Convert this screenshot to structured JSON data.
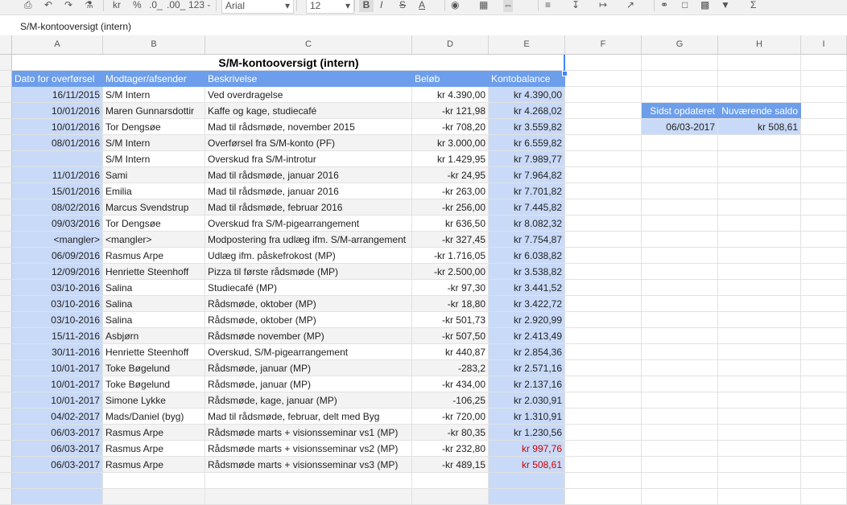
{
  "toolbar": {
    "currency_format": "kr",
    "percent_format": "%",
    "decrease_decimals": ".0_",
    "increase_decimals": ".00_",
    "more_formats": "123 -",
    "font_family": "Arial",
    "font_size": "12",
    "bold": "B",
    "italic": "I",
    "strikethrough": "S",
    "text_color": "A"
  },
  "formula_bar": {
    "value": "S/M-kontooversigt (intern)"
  },
  "columns": [
    "A",
    "B",
    "C",
    "D",
    "E",
    "F",
    "G",
    "H",
    "I"
  ],
  "sheet": {
    "title": "S/M-kontooversigt (intern)",
    "headers": {
      "date": "Dato for overførsel",
      "party": "Modtager/afsender",
      "desc": "Beskrivelse",
      "amount": "Beløb",
      "balance": "Kontobalance"
    },
    "rows": [
      {
        "date": "16/11/2015",
        "party": "S/M Intern",
        "desc": "Ved overdragelse",
        "amount": "kr 4.390,00",
        "balance": "kr 4.390,00",
        "neg": false
      },
      {
        "date": "10/01/2016",
        "party": "Maren Gunnarsdottir",
        "desc": "Kaffe og kage, studiecafé",
        "amount": "-kr 121,98",
        "balance": "kr 4.268,02",
        "neg": false
      },
      {
        "date": "10/01/2016",
        "party": "Tor Dengsøe",
        "desc": "Mad til rådsmøde, november 2015",
        "amount": "-kr 708,20",
        "balance": "kr 3.559,82",
        "neg": false
      },
      {
        "date": "08/01/2016",
        "party": "S/M Intern",
        "desc": "Overførsel fra S/M-konto (PF)",
        "amount": "kr 3.000,00",
        "balance": "kr 6.559,82",
        "neg": false
      },
      {
        "date": "",
        "party": "S/M Intern",
        "desc": "Overskud fra S/M-introtur",
        "amount": "kr 1.429,95",
        "balance": "kr 7.989,77",
        "neg": false
      },
      {
        "date": "11/01/2016",
        "party": "Sami",
        "desc": "Mad til rådsmøde, januar 2016",
        "amount": "-kr 24,95",
        "balance": "kr 7.964,82",
        "neg": false
      },
      {
        "date": "15/01/2016",
        "party": "Emilia",
        "desc": "Mad til rådsmøde, januar 2016",
        "amount": "-kr 263,00",
        "balance": "kr 7.701,82",
        "neg": false
      },
      {
        "date": "08/02/2016",
        "party": "Marcus Svendstrup",
        "desc": "Mad til rådsmøde, februar 2016",
        "amount": "-kr 256,00",
        "balance": "kr 7.445,82",
        "neg": false
      },
      {
        "date": "09/03/2016",
        "party": "Tor Dengsøe",
        "desc": "Overskud fra S/M-pigearrangement",
        "amount": "kr 636,50",
        "balance": "kr 8.082,32",
        "neg": false
      },
      {
        "date": "<mangler>",
        "party": "<mangler>",
        "desc": "Modpostering fra udlæg ifm. S/M-arrangement",
        "amount": "-kr 327,45",
        "balance": "kr 7.754,87",
        "neg": false
      },
      {
        "date": "06/09/2016",
        "party": "Rasmus Arpe",
        "desc": "Udlæg ifm. påskefrokost (MP)",
        "amount": "-kr 1.716,05",
        "balance": "kr 6.038,82",
        "neg": false
      },
      {
        "date": "12/09/2016",
        "party": "Henriette Steenhoff",
        "desc": "Pizza til første rådsmøde (MP)",
        "amount": "-kr 2.500,00",
        "balance": "kr 3.538,82",
        "neg": false
      },
      {
        "date": "03/10-2016",
        "party": "Salina",
        "desc": "Studiecafé (MP)",
        "amount": "-kr 97,30",
        "balance": "kr 3.441,52",
        "neg": false
      },
      {
        "date": "03/10-2016",
        "party": "Salina",
        "desc": "Rådsmøde, oktober (MP)",
        "amount": "-kr 18,80",
        "balance": "kr 3.422,72",
        "neg": false
      },
      {
        "date": "03/10-2016",
        "party": "Salina",
        "desc": "Rådsmøde, oktober (MP)",
        "amount": "-kr 501,73",
        "balance": "kr 2.920,99",
        "neg": false
      },
      {
        "date": "15/11-2016",
        "party": "Asbjørn",
        "desc": "Rådsmøde november (MP)",
        "amount": "-kr 507,50",
        "balance": "kr 2.413,49",
        "neg": false
      },
      {
        "date": "30/11-2016",
        "party": "Henriette Steenhoff",
        "desc": "Overskud, S/M-pigearrangement",
        "amount": "kr 440,87",
        "balance": "kr 2.854,36",
        "neg": false
      },
      {
        "date": "10/01-2017",
        "party": "Toke Bøgelund",
        "desc": "Rådsmøde, januar (MP)",
        "amount": "-283,2",
        "balance": "kr 2.571,16",
        "neg": false
      },
      {
        "date": "10/01-2017",
        "party": "Toke Bøgelund",
        "desc": "Rådsmøde, januar (MP)",
        "amount": "-kr 434,00",
        "balance": "kr 2.137,16",
        "neg": false
      },
      {
        "date": "10/01-2017",
        "party": "Simone Lykke",
        "desc": "Rådsmøde, kage, januar (MP)",
        "amount": "-106,25",
        "balance": "kr 2.030,91",
        "neg": false
      },
      {
        "date": "04/02-2017",
        "party": "Mads/Daniel (byg)",
        "desc": "Mad til rådsmøde, februar, delt med Byg",
        "amount": "-kr 720,00",
        "balance": "kr 1.310,91",
        "neg": false
      },
      {
        "date": "06/03-2017",
        "party": "Rasmus Arpe",
        "desc": "Rådsmøde marts + visionsseminar vs1 (MP)",
        "amount": "-kr 80,35",
        "balance": "kr 1.230,56",
        "neg": false
      },
      {
        "date": "06/03-2017",
        "party": "Rasmus Arpe",
        "desc": "Rådsmøde marts + visionsseminar vs2 (MP)",
        "amount": "-kr 232,80",
        "balance": "kr 997,76",
        "neg": true
      },
      {
        "date": "06/03-2017",
        "party": "Rasmus Arpe",
        "desc": "Rådsmøde marts + visionsseminar vs3 (MP)",
        "amount": "-kr 489,15",
        "balance": "kr 508,61",
        "neg": true
      }
    ]
  },
  "summary": {
    "updated_label": "Sidst opdateret",
    "balance_label": "Nuværende saldo",
    "updated_value": "06/03-2017",
    "balance_value": "kr 508,61"
  },
  "colors": {
    "header_blue": "#6d9eeb",
    "light_blue": "#c9daf8",
    "negative_red": "#cc0000"
  }
}
